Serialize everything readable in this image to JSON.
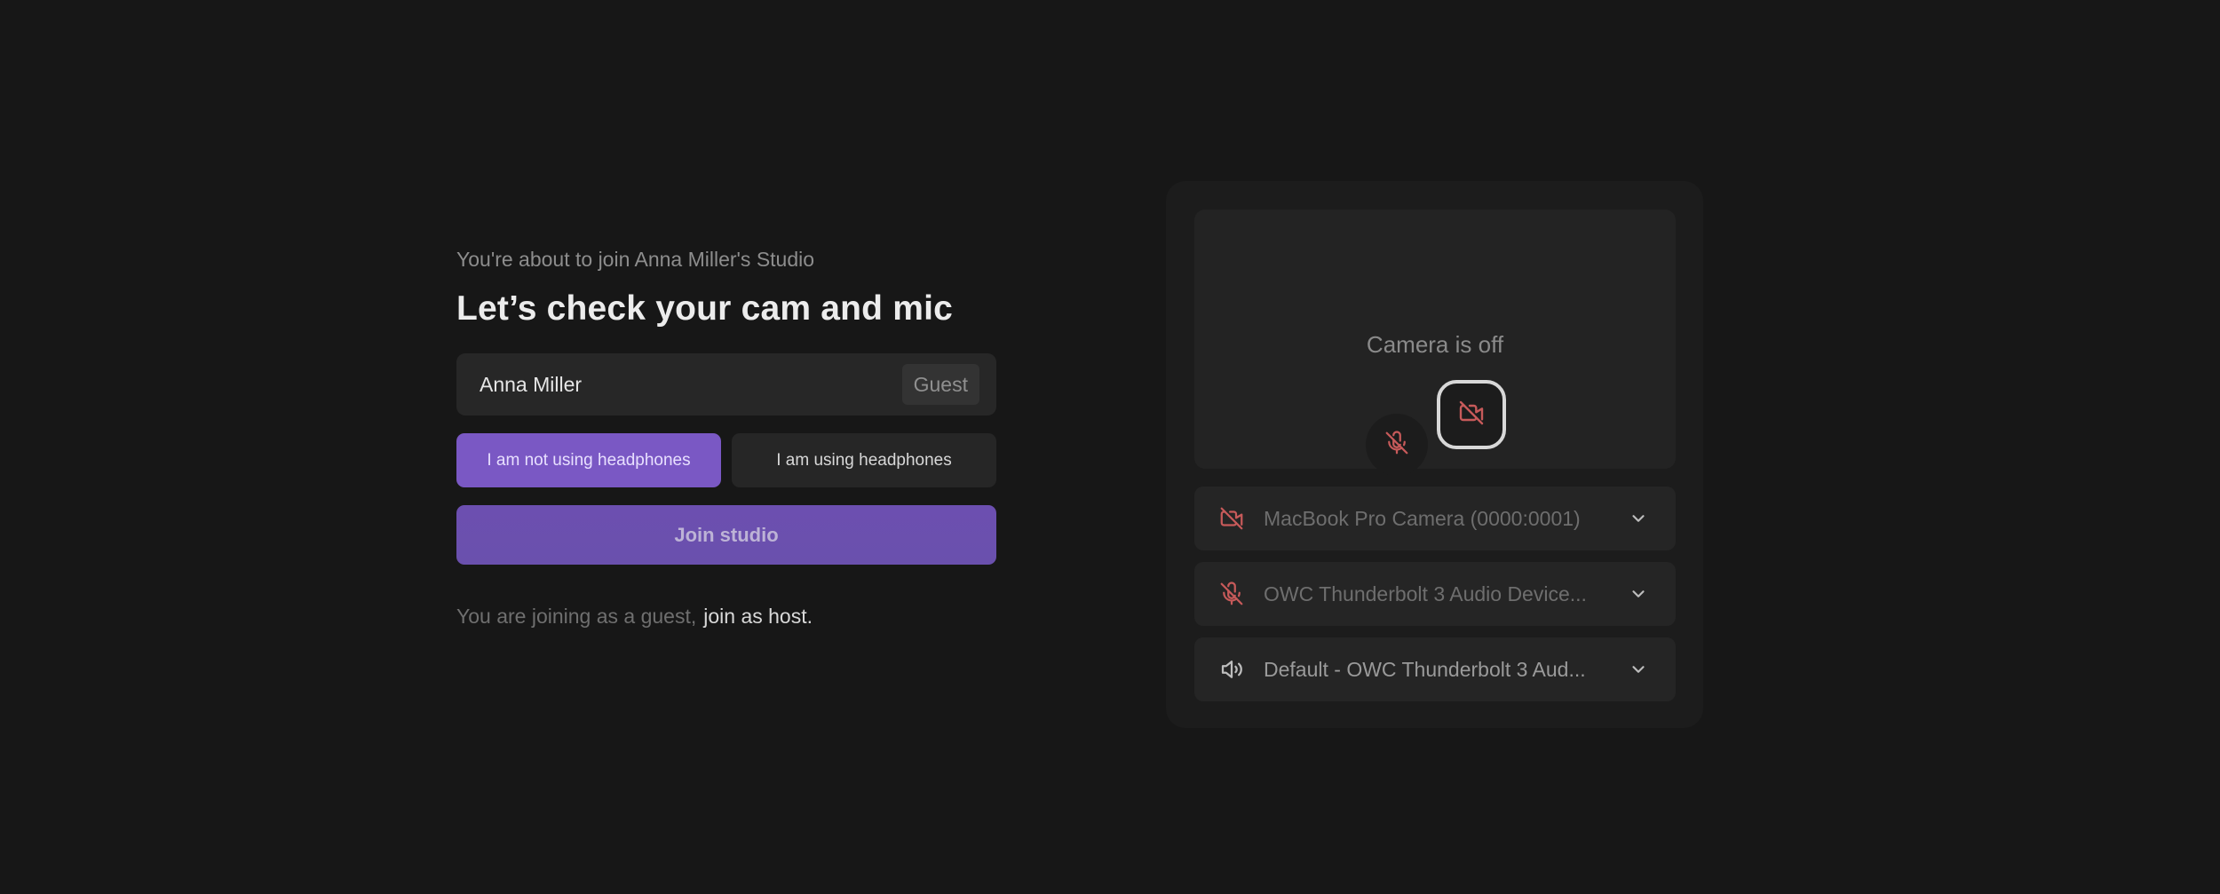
{
  "join": {
    "subtitle": "You're about to join Anna Miller's Studio",
    "title": "Let’s check your cam and mic",
    "name_value": "Anna Miller",
    "role_badge": "Guest",
    "headphones_off_label": "I am not using headphones",
    "headphones_on_label": "I am using headphones",
    "join_button_label": "Join studio",
    "guest_note": "You are joining as a guest,",
    "host_link": "join as host."
  },
  "preview": {
    "camera_status": "Camera is off",
    "mic_muted": true,
    "camera_disabled": true
  },
  "devices": {
    "camera": "MacBook Pro Camera (0000:0001)",
    "microphone": "OWC Thunderbolt 3 Audio Device...",
    "speaker": "Default - OWC Thunderbolt 3 Aud..."
  },
  "colors": {
    "background": "#171717",
    "accent": "#7a58c4",
    "muted_red": "#c75a5a"
  },
  "icons": {
    "mic_off": "mic-off-icon",
    "camera_off": "camera-off-icon",
    "speaker": "speaker-icon",
    "chevron": "chevron-down-icon"
  }
}
